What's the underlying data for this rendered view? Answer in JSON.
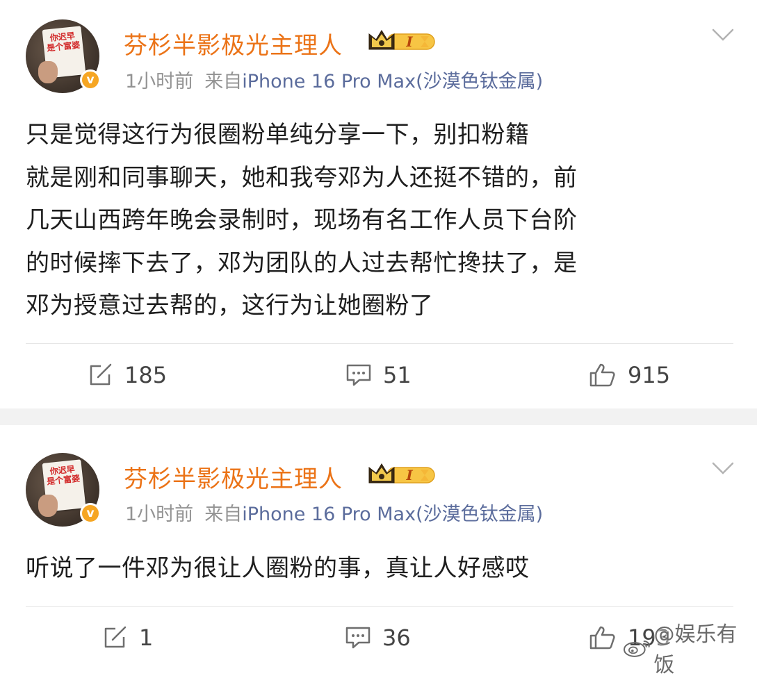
{
  "posts": [
    {
      "avatar_text": "你迟早\n是个富婆",
      "verified_badge": "v",
      "username": "芬杉半影极光主理人",
      "level_badge": "I",
      "time": "1小时前",
      "from_label": "来自",
      "source": "iPhone 16 Pro Max(沙漠色钛金属)",
      "content": "只是觉得这行为很圈粉单纯分享一下，别扣粉籍\n就是刚和同事聊天，她和我夸邓为人还挺不错的，前\n几天山西跨年晚会录制时，现场有名工作人员下台阶\n的时候摔下去了，邓为团队的人过去帮忙搀扶了，是\n邓为授意过去帮的，这行为让她圈粉了",
      "actions": {
        "repost": "185",
        "comment": "51",
        "like": "915"
      }
    },
    {
      "avatar_text": "你迟早\n是个富婆",
      "verified_badge": "v",
      "username": "芬杉半影极光主理人",
      "level_badge": "I",
      "time": "1小时前",
      "from_label": "来自",
      "source": "iPhone 16 Pro Max(沙漠色钛金属)",
      "content": "听说了一件邓为很让人圈粉的事，真让人好感哎",
      "actions": {
        "repost": "1",
        "comment": "36",
        "like": "193"
      }
    }
  ],
  "watermark": "@娱乐有饭",
  "icons": [
    "repost-icon",
    "comment-icon",
    "like-icon",
    "chevron-down-icon",
    "crown-icon",
    "weibo-logo-icon"
  ],
  "colors": {
    "username": "#eb7317",
    "source": "#5b6c9c",
    "meta": "#939393",
    "badge": "#f6a623"
  }
}
